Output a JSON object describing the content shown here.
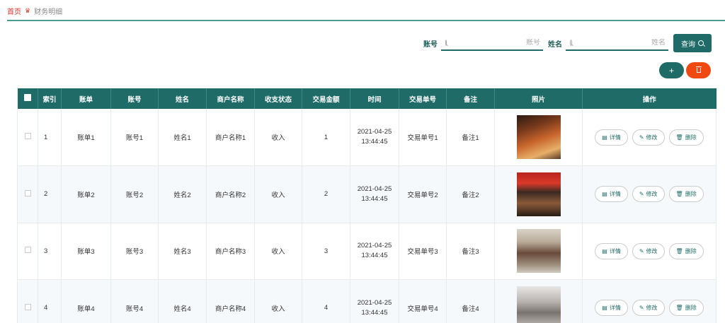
{
  "breadcrumb": {
    "home": "首页",
    "current": "财务明细"
  },
  "search": {
    "account_label": "账号",
    "account_placeholder": "账号",
    "name_label": "姓名",
    "name_placeholder": "姓名",
    "query_label": "查询"
  },
  "actions": {
    "add_label": "+"
  },
  "table": {
    "headers": [
      "索引",
      "账单",
      "账号",
      "姓名",
      "商户名称",
      "收支状态",
      "交易金额",
      "时间",
      "交易单号",
      "备注",
      "照片",
      "操作"
    ],
    "rows": [
      {
        "index": "1",
        "bill": "账单1",
        "account": "账号1",
        "name": "姓名1",
        "merchant": "商户名称1",
        "status": "收入",
        "amount": "1",
        "date": "2021-04-25",
        "time": "13:44:45",
        "tx": "交易单号1",
        "note": "备注1"
      },
      {
        "index": "2",
        "bill": "账单2",
        "account": "账号2",
        "name": "姓名2",
        "merchant": "商户名称2",
        "status": "收入",
        "amount": "2",
        "date": "2021-04-25",
        "time": "13:44:45",
        "tx": "交易单号2",
        "note": "备注2"
      },
      {
        "index": "3",
        "bill": "账单3",
        "account": "账号3",
        "name": "姓名3",
        "merchant": "商户名称3",
        "status": "收入",
        "amount": "3",
        "date": "2021-04-25",
        "time": "13:44:45",
        "tx": "交易单号3",
        "note": "备注3"
      },
      {
        "index": "4",
        "bill": "账单4",
        "account": "账号4",
        "name": "姓名4",
        "merchant": "商户名称4",
        "status": "收入",
        "amount": "4",
        "date": "2021-04-25",
        "time": "13:44:45",
        "tx": "交易单号4",
        "note": "备注4"
      }
    ],
    "ops": {
      "detail": "详情",
      "edit": "修改",
      "delete": "删除"
    }
  },
  "colors": {
    "primary": "#1e6b67",
    "danger": "#f04a12",
    "breadcrumb": "#d6342a"
  }
}
